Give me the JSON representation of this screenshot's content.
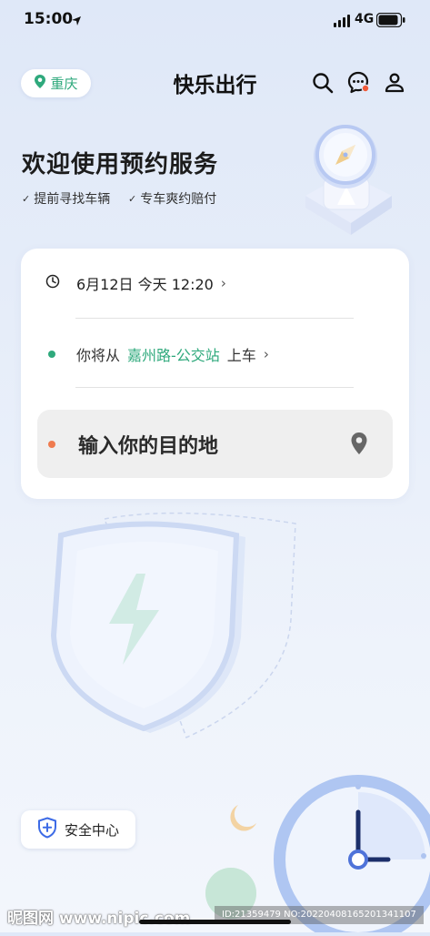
{
  "status_bar": {
    "time": "15:00",
    "network": "4G"
  },
  "header": {
    "city": "重庆",
    "title": "快乐出行",
    "icons": [
      "search-icon",
      "message-icon",
      "user-icon"
    ]
  },
  "welcome": {
    "title": "欢迎使用预约服务",
    "features": [
      "提前寻找车辆",
      "专车爽约赔付"
    ],
    "check_mark": "✓"
  },
  "booking": {
    "time_text": "6月12日 今天 12:20",
    "pickup_prefix": "你将从",
    "pickup_station": "嘉州路-公交站",
    "pickup_suffix": "上车",
    "destination_placeholder": "输入你的目的地",
    "chevron": "›"
  },
  "safety": {
    "label": "安全中心"
  },
  "watermark": {
    "left": "昵图网 www.nipic.com",
    "right": "ID:21359479 NO:20220408165201341107"
  },
  "colors": {
    "accent_green": "#2fa97c",
    "destination_dot": "#ef7b4f",
    "notification_dot": "#ef5a3a"
  }
}
